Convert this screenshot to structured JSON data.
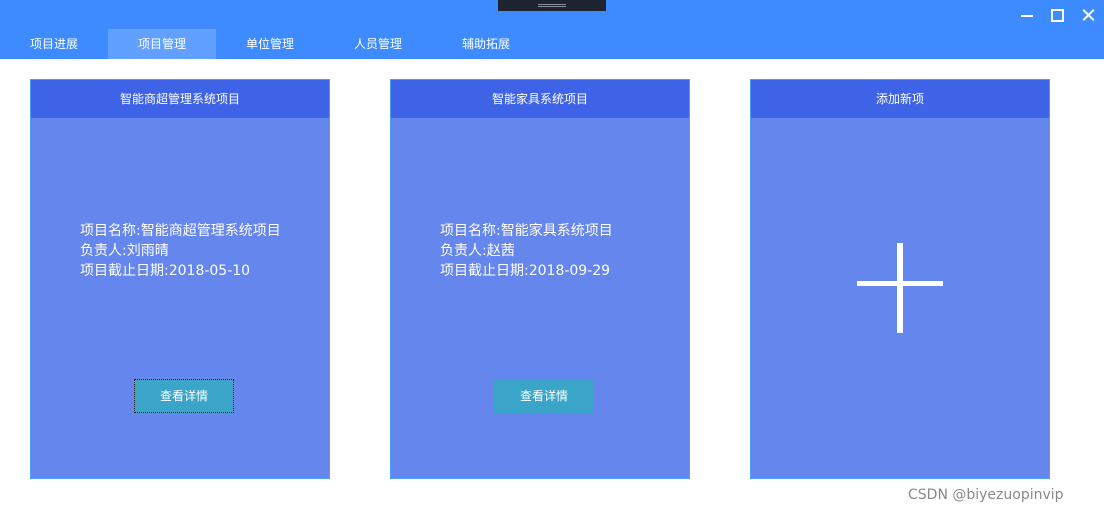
{
  "tabs": [
    {
      "label": "项目进展",
      "active": false
    },
    {
      "label": "项目管理",
      "active": true
    },
    {
      "label": "单位管理",
      "active": false
    },
    {
      "label": "人员管理",
      "active": false
    },
    {
      "label": "辅助拓展",
      "active": false
    }
  ],
  "cards": [
    {
      "header": "智能商超管理系统项目",
      "info": [
        "项目名称:智能商超管理系统项目",
        "负责人:刘雨晴",
        "项目截止日期:2018-05-10"
      ],
      "button": "查看详情"
    },
    {
      "header": "智能家具系统项目",
      "info": [
        "项目名称:智能家具系统项目",
        "负责人:赵茜",
        "项目截止日期:2018-09-29"
      ],
      "button": "查看详情"
    },
    {
      "header": "添加新项",
      "icon": "plus-icon"
    }
  ],
  "watermark": "CSDN @biyezuopinvip",
  "colors": {
    "titlebar": "#3d8bff",
    "tab_active": "#62a0ff",
    "card_body": "#6586ec",
    "card_header": "#3f63e6",
    "button": "#3aa5c8"
  }
}
